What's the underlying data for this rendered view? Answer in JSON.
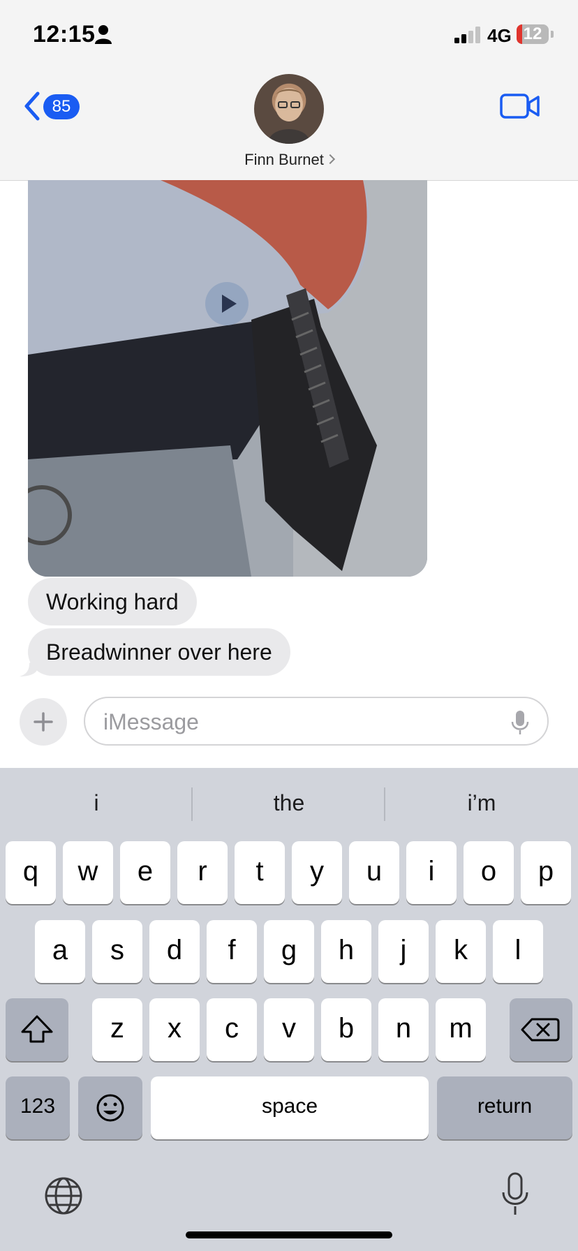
{
  "status_bar": {
    "time": "12:15",
    "network": "4G",
    "battery_level": "12"
  },
  "header": {
    "back_badge_count": "85",
    "contact_name": "Finn Burnet"
  },
  "messages": [
    {
      "text": "Working hard"
    },
    {
      "text": "Breadwinner over here"
    }
  ],
  "compose": {
    "placeholder": "iMessage"
  },
  "keyboard": {
    "suggestions": [
      "i",
      "the",
      "i’m"
    ],
    "row1": [
      "q",
      "w",
      "e",
      "r",
      "t",
      "y",
      "u",
      "i",
      "o",
      "p"
    ],
    "row2": [
      "a",
      "s",
      "d",
      "f",
      "g",
      "h",
      "j",
      "k",
      "l"
    ],
    "row3": [
      "z",
      "x",
      "c",
      "v",
      "b",
      "n",
      "m"
    ],
    "numbers_label": "123",
    "space_label": "space",
    "return_label": "return"
  },
  "colors": {
    "accent": "#1a5cf2",
    "bubble_bg": "#e9e9eb",
    "keyboard_bg": "#d1d4db",
    "battery_low": "#e0342d"
  }
}
